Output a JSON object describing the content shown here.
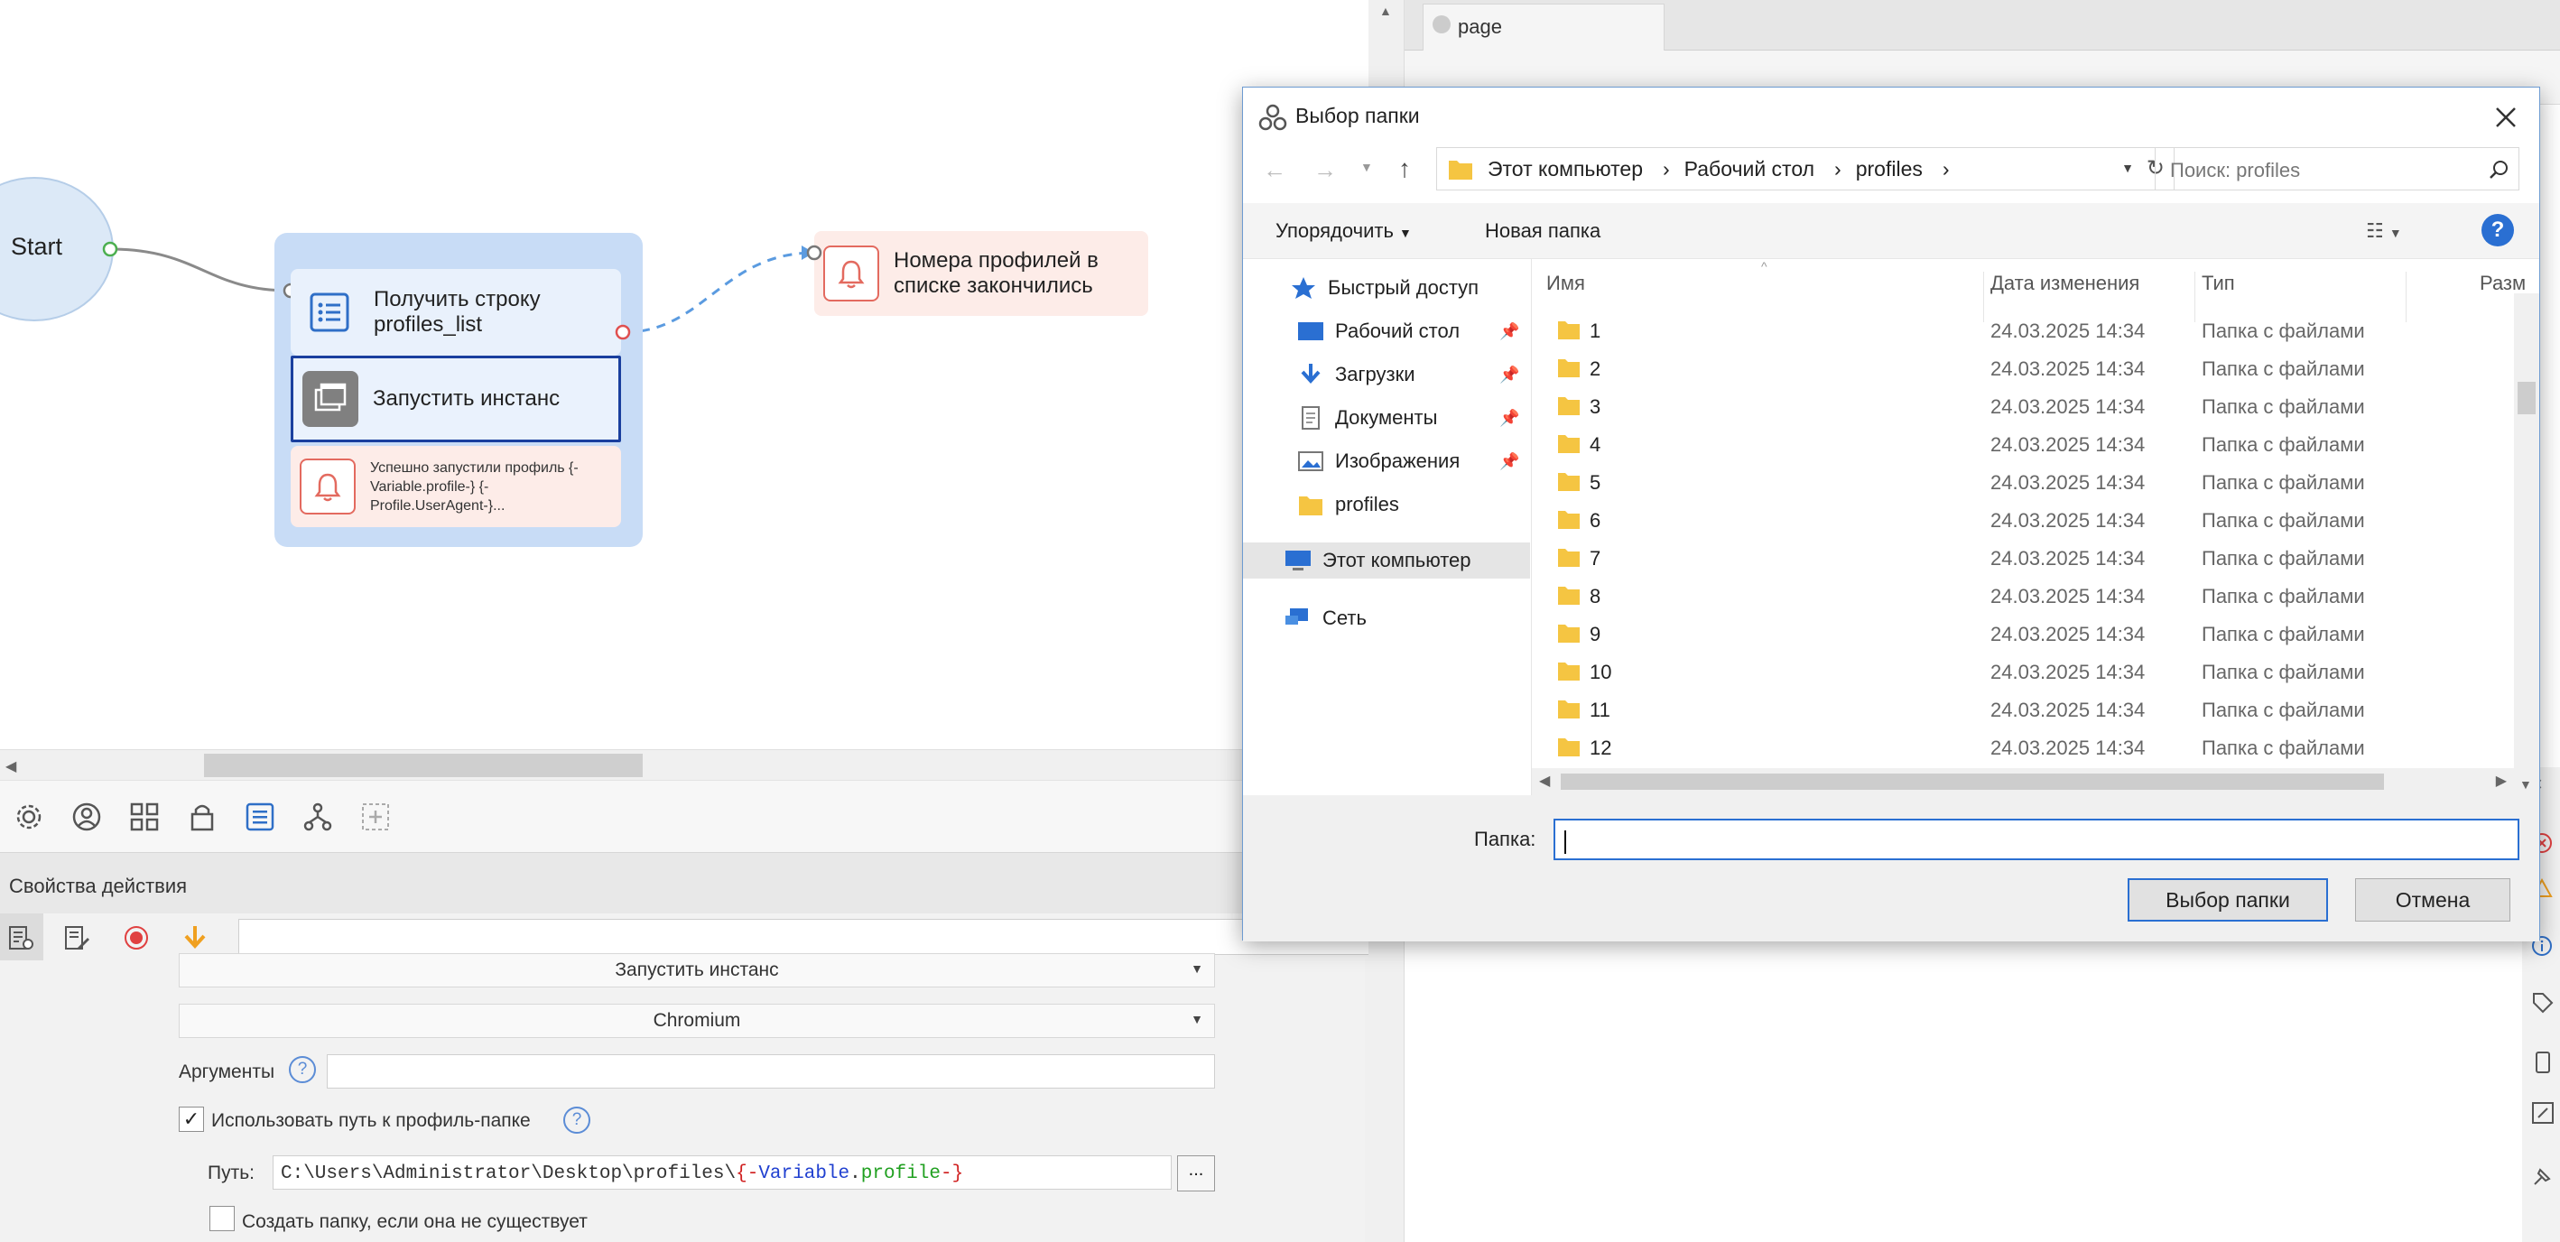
{
  "canvas": {
    "start_label": "Start",
    "block1_text": "Получить строку profiles_list",
    "block2_text": "Запустить инстанс",
    "block3_text": "Успешно запустили профиль {-Variable.profile-} {-Profile.UserAgent-}...",
    "notify_text": "Номера профилей в списке закончились"
  },
  "toolbar": {
    "icons": [
      "settings-icon",
      "user-icon",
      "grid-icon",
      "lock-icon",
      "list-icon",
      "tree-icon",
      "add-icon"
    ]
  },
  "props": {
    "header": "Свойства действия",
    "action_select": "Запустить инстанс",
    "browser_select": "Chromium",
    "args_label": "Аргументы",
    "use_profile_label": "Использовать путь к профиль-папке",
    "use_profile_checked": true,
    "path_label": "Путь:",
    "path_prefix": "C:\\Users\\Administrator\\Desktop\\profiles\\",
    "path_var_open": "{-",
    "path_var_name": "Variable",
    "path_var_dot": ".",
    "path_var_field": "profile",
    "path_var_close": "-}",
    "browse_label": "...",
    "create_folder_label": "Создать папку, если она не существует"
  },
  "rightapp": {
    "tab_label": "page"
  },
  "dialog": {
    "title": "Выбор папки",
    "breadcrumb": [
      "Этот компьютер",
      "Рабочий стол",
      "profiles"
    ],
    "search_placeholder": "Поиск: profiles",
    "organize_label": "Упорядочить",
    "new_folder_label": "Новая папка",
    "nav": {
      "quick_access": "Быстрый доступ",
      "desktop": "Рабочий стол",
      "downloads": "Загрузки",
      "documents": "Документы",
      "pictures": "Изображения",
      "profiles": "profiles",
      "this_pc": "Этот компьютер",
      "network": "Сеть"
    },
    "columns": {
      "name": "Имя",
      "date": "Дата изменения",
      "type": "Тип",
      "size": "Разм"
    },
    "rows": [
      {
        "name": "1",
        "date": "24.03.2025 14:34",
        "type": "Папка с файлами"
      },
      {
        "name": "2",
        "date": "24.03.2025 14:34",
        "type": "Папка с файлами"
      },
      {
        "name": "3",
        "date": "24.03.2025 14:34",
        "type": "Папка с файлами"
      },
      {
        "name": "4",
        "date": "24.03.2025 14:34",
        "type": "Папка с файлами"
      },
      {
        "name": "5",
        "date": "24.03.2025 14:34",
        "type": "Папка с файлами"
      },
      {
        "name": "6",
        "date": "24.03.2025 14:34",
        "type": "Папка с файлами"
      },
      {
        "name": "7",
        "date": "24.03.2025 14:34",
        "type": "Папка с файлами"
      },
      {
        "name": "8",
        "date": "24.03.2025 14:34",
        "type": "Папка с файлами"
      },
      {
        "name": "9",
        "date": "24.03.2025 14:34",
        "type": "Папка с файлами"
      },
      {
        "name": "10",
        "date": "24.03.2025 14:34",
        "type": "Папка с файлами"
      },
      {
        "name": "11",
        "date": "24.03.2025 14:34",
        "type": "Папка с файлами"
      },
      {
        "name": "12",
        "date": "24.03.2025 14:34",
        "type": "Папка с файлами"
      }
    ],
    "folder_label": "Папка:",
    "folder_value": "",
    "select_button": "Выбор папки",
    "cancel_button": "Отмена"
  },
  "colors": {
    "accent": "#1a3f9e",
    "group_bg": "#c8dcf6",
    "notify_bg": "#fdece8",
    "folder": "#f5c542"
  }
}
